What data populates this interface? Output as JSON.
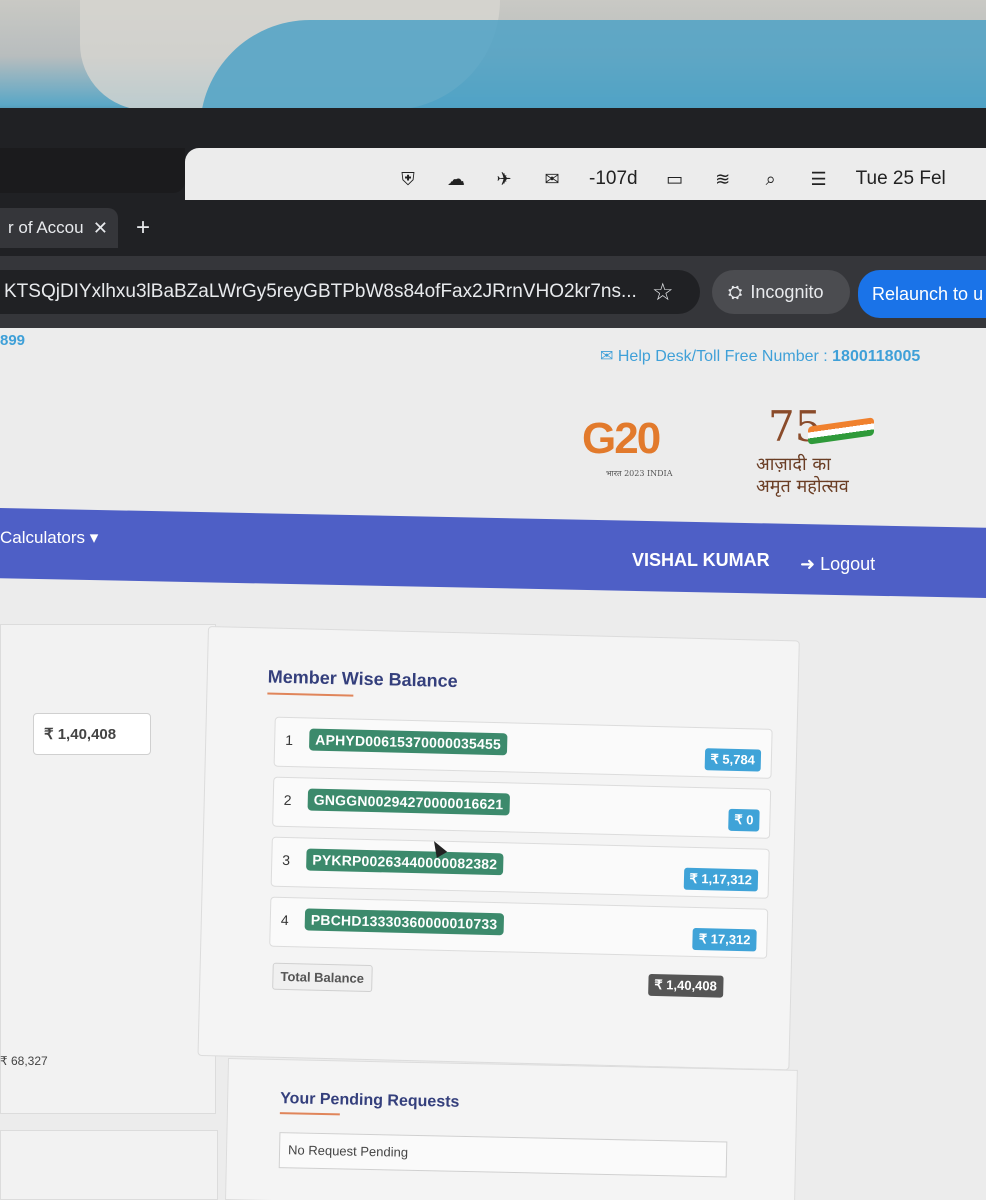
{
  "menubar": {
    "battery_text": "-107d",
    "datetime": "Tue 25 Fel"
  },
  "browser": {
    "tab_title": "r of Accou",
    "url": "KTSQjDIYxlhxu3lBaBZaLWrGy5reyGBTPbW8s84ofFax2JRrnVHO2kr7ns...",
    "incognito_label": "Incognito",
    "relaunch_label": "Relaunch to u"
  },
  "header": {
    "account_fragment": "899",
    "helpdesk_label": "Help Desk/Toll Free Number : ",
    "helpdesk_number": "1800118005",
    "g20_text": "G20",
    "g20_sub": "भारत 2023 INDIA",
    "azadi_75": "75",
    "azadi_line1": "आज़ादी का",
    "azadi_line2": "अमृत महोत्सव"
  },
  "nav": {
    "calculators": "Calculators ▾",
    "user": "VISHAL KUMAR",
    "logout": "Logout"
  },
  "left_panel": {
    "balance": "₹ 1,40,408",
    "footer_value": "₹ 68,327"
  },
  "member_wise": {
    "title": "Member Wise Balance",
    "rows": [
      {
        "num": "1",
        "id": "APHYD00615370000035455",
        "balance": "₹ 5,784"
      },
      {
        "num": "2",
        "id": "GNGGN00294270000016621",
        "balance": "₹ 0"
      },
      {
        "num": "3",
        "id": "PYKRP00263440000082382",
        "balance": "₹ 1,17,312"
      },
      {
        "num": "4",
        "id": "PBCHD13330360000010733",
        "balance": "₹ 17,312"
      }
    ],
    "total_label": "Total Balance",
    "total_value": "₹ 1,40,408"
  },
  "pending": {
    "title": "Your Pending Requests",
    "message": "No Request Pending"
  },
  "colors": {
    "nav_bg": "#4e5fc6",
    "id_badge": "#3c8a6c",
    "balance_badge": "#3fa3d8",
    "title": "#343f7c",
    "accent_underline": "#e0855a"
  }
}
